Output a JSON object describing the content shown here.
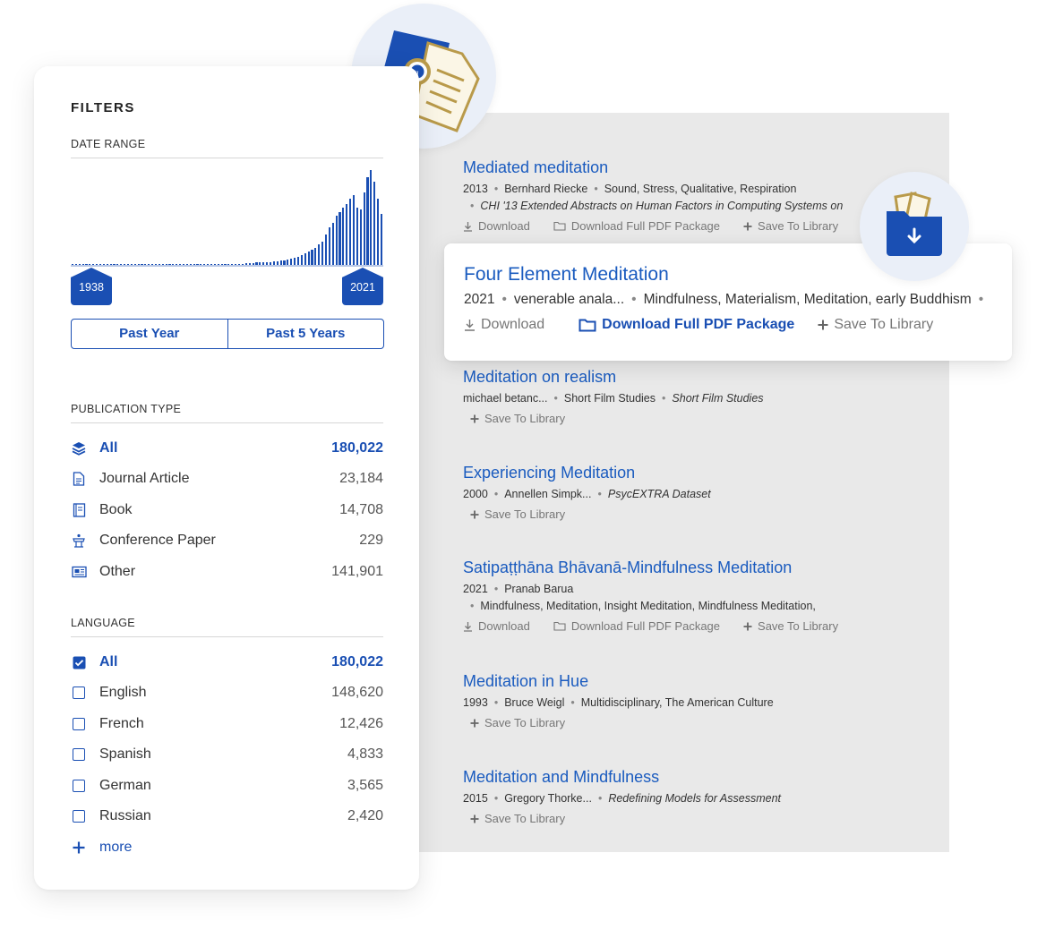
{
  "filters": {
    "heading": "FILTERS",
    "date_range": {
      "label": "DATE RANGE",
      "min_year": "1938",
      "max_year": "2021",
      "quick": [
        "Past Year",
        "Past 5 Years"
      ],
      "histogram_values": [
        1,
        1,
        1,
        1,
        1,
        1,
        1,
        1,
        1,
        1,
        1,
        1,
        1,
        1,
        1,
        1,
        1,
        1,
        1,
        1,
        1,
        1,
        1,
        1,
        1,
        1,
        1,
        1,
        1,
        1,
        1,
        1,
        1,
        1,
        1,
        1,
        1,
        1,
        1,
        1,
        1,
        1,
        1,
        1,
        1,
        1,
        1,
        1,
        1,
        1,
        2,
        2,
        2,
        3,
        3,
        3,
        3,
        3,
        4,
        4,
        5,
        5,
        6,
        7,
        8,
        10,
        12,
        14,
        16,
        18,
        20,
        24,
        28,
        36,
        44,
        50,
        58,
        62,
        68,
        72,
        78,
        82,
        68,
        66,
        86,
        104,
        112,
        98,
        78,
        60
      ]
    },
    "publication_type": {
      "label": "PUBLICATION TYPE",
      "items": [
        {
          "label": "All",
          "count": "180,022",
          "icon": "layers-icon",
          "active": true
        },
        {
          "label": "Journal Article",
          "count": "23,184",
          "icon": "document-icon"
        },
        {
          "label": "Book",
          "count": "14,708",
          "icon": "book-icon"
        },
        {
          "label": "Conference Paper",
          "count": "229",
          "icon": "podium-icon"
        },
        {
          "label": "Other",
          "count": "141,901",
          "icon": "newspaper-icon"
        }
      ]
    },
    "language": {
      "label": "LANGUAGE",
      "items": [
        {
          "label": "All",
          "count": "180,022",
          "checked": true
        },
        {
          "label": "English",
          "count": "148,620"
        },
        {
          "label": "French",
          "count": "12,426"
        },
        {
          "label": "Spanish",
          "count": "4,833"
        },
        {
          "label": "German",
          "count": "3,565"
        },
        {
          "label": "Russian",
          "count": "2,420"
        }
      ],
      "more_label": "more"
    }
  },
  "actions": {
    "download": "Download",
    "download_pdf": "Download Full PDF Package",
    "save": "Save To Library"
  },
  "results": [
    {
      "title": "Mediated meditation",
      "meta": [
        "2013",
        "Bernhard Riecke",
        "Sound, Stress, Qualitative, Respiration"
      ],
      "sub": "CHI '13 Extended Abstracts on Human Factors in Computing Systems on"
    },
    {
      "title": "Four Element Meditation",
      "meta": [
        "2021",
        "venerable anala...",
        "Mindfulness, Materialism, Meditation, early Buddhism"
      ]
    },
    {
      "title": "Meditation on realism",
      "meta": [
        "michael betanc...",
        "Short Film Studies",
        "Short Film Studies"
      ]
    },
    {
      "title": "Experiencing Meditation",
      "meta": [
        "2000",
        "Annellen Simpk...",
        "PsycEXTRA Dataset"
      ]
    },
    {
      "title": "Satipaṭṭhāna Bhāvanā-Mindfulness Meditation",
      "meta": [
        "2021",
        "Pranab Barua"
      ],
      "sub": "Mindfulness, Meditation, Insight Meditation, Mindfulness Meditation,"
    },
    {
      "title": "Meditation in Hue",
      "meta": [
        "1993",
        "Bruce Weigl",
        "Multidisciplinary, The American Culture"
      ]
    },
    {
      "title": "Meditation and Mindfulness",
      "meta": [
        "2015",
        "Gregory Thorke...",
        "Redefining Models for Assessment"
      ]
    }
  ],
  "colors": {
    "brand_blue": "#1a4fb3",
    "link_blue": "#1a5bbf",
    "gold": "#b99a4a",
    "panel_gray": "#e9e9e9"
  }
}
